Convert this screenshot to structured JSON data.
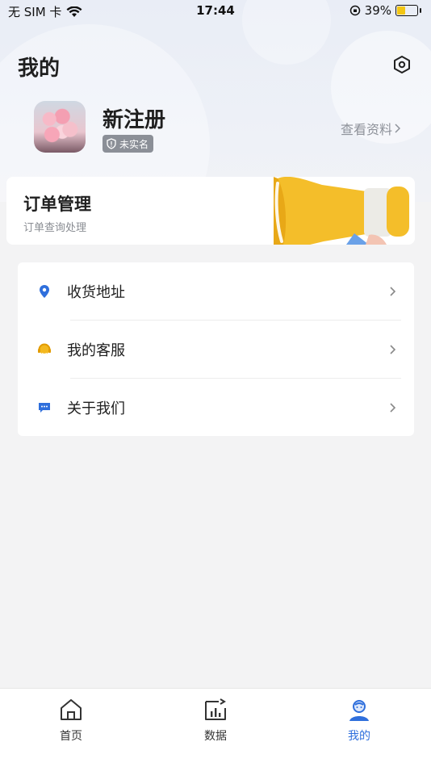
{
  "status_bar": {
    "carrier": "无 SIM 卡",
    "time": "17:44",
    "battery": "39%"
  },
  "header": {
    "title": "我的"
  },
  "profile": {
    "username": "新注册",
    "badge": "未实名",
    "view_profile": "查看资料"
  },
  "order_card": {
    "title": "订单管理",
    "subtitle": "订单查询处理"
  },
  "menu": {
    "items": [
      {
        "label": "收货地址",
        "icon": "location-pin-icon"
      },
      {
        "label": "我的客服",
        "icon": "customer-service-icon"
      },
      {
        "label": "关于我们",
        "icon": "chat-bubble-icon"
      }
    ]
  },
  "tabbar": {
    "tabs": [
      {
        "label": "首页",
        "icon": "home-icon"
      },
      {
        "label": "数据",
        "icon": "chart-icon"
      },
      {
        "label": "我的",
        "icon": "profile-icon",
        "active": true
      }
    ]
  },
  "colors": {
    "accent": "#2f6fdc",
    "megaphone": "#f3b81f",
    "badge_bg": "#8b8f97"
  }
}
